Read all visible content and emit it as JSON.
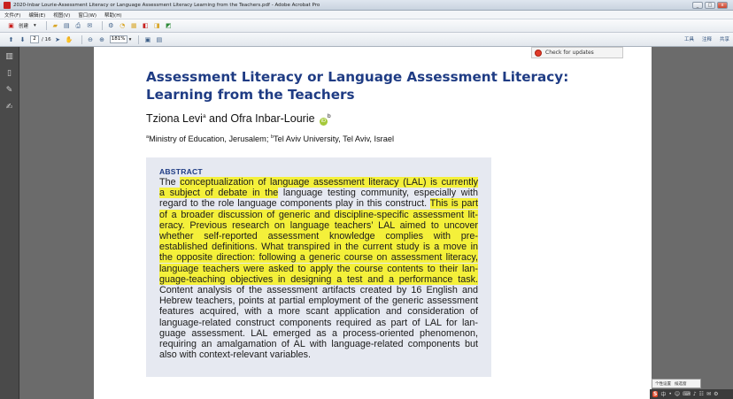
{
  "window": {
    "title": "2020-Inbar Lourie-Assessment Literacy or Language Assessment Literacy Learning from the Teachers.pdf - Adobe Acrobat Pro",
    "minimize": "_",
    "maximize": "□",
    "close": "x"
  },
  "menu": [
    "文件(F)",
    "编辑(E)",
    "视图(V)",
    "窗口(W)",
    "帮助(H)"
  ],
  "toolbar": {
    "create_label": "创建",
    "page_current": "2",
    "page_total": "/ 16",
    "zoom": "181%",
    "right_tools": [
      "工具",
      "注释",
      "共享"
    ]
  },
  "check_updates": "Check for updates",
  "paper": {
    "title": "Assessment Literacy or Language Assessment Literacy: Learning from the Teachers",
    "author1": "Tziona Levi",
    "author1_sup": "a",
    "and": " and Ofra Inbar-Lourie ",
    "orcid": "iD",
    "author2_sup": "b",
    "affil_a_sup": "a",
    "affil_a": "Ministry of Education, Jerusalem; ",
    "affil_b_sup": "b",
    "affil_b": "Tel Aviv University, Tel Aviv, Israel",
    "abstract_heading": "ABSTRACT",
    "abstract_lines": [
      {
        "pre": "The ",
        "hl": "conceptualization of language assessment literacy (LAL) is currently",
        "post": ""
      },
      {
        "pre": "",
        "hl": "a subject of debate in the",
        "post": " language testing community, especially with"
      },
      {
        "pre": "regard to the role language components play in this construct. ",
        "hl": "This is part",
        "post": ""
      },
      {
        "pre": "",
        "hl": "of a broader discussion of generic and discipline-specific assessment lit-",
        "post": ""
      },
      {
        "pre": "",
        "hl": "eracy. Previous research on language teachers’ LAL aimed to uncover",
        "post": ""
      },
      {
        "pre": "",
        "hl": "whether self-reported assessment knowledge complies with pre-",
        "post": ""
      },
      {
        "pre": "",
        "hl": "established definitions. What transpired in the current study is a move in",
        "post": ""
      },
      {
        "pre": "",
        "hl": "the opposite direction: following a generic course on assessment literacy,",
        "post": ""
      },
      {
        "pre": "",
        "hl": "language teachers were asked to apply the course contents to their lan-",
        "post": ""
      },
      {
        "pre": "",
        "hl": "guage-teaching objectives in designing a test and a performance task.",
        "post": ""
      },
      {
        "pre": "Content analysis of the assessment artifacts created by 16 English and",
        "hl": "",
        "post": ""
      },
      {
        "pre": "Hebrew teachers, points at partial employment of the generic assessment",
        "hl": "",
        "post": ""
      },
      {
        "pre": "features acquired, with a more scant application and consideration of",
        "hl": "",
        "post": ""
      },
      {
        "pre": "language-related construct components required as part of LAL for lan-",
        "hl": "",
        "post": ""
      },
      {
        "pre": "guage assessment. LAL emerged as a process-oriented phenomenon,",
        "hl": "",
        "post": ""
      },
      {
        "pre": "requiring an amalgamation of AL with language-related components but",
        "hl": "",
        "post": ""
      },
      {
        "pre": "also with context-relevant variables.",
        "hl": "",
        "post": ""
      }
    ]
  },
  "ime": {
    "popup": [
      "个性设置",
      "候选窗"
    ],
    "tray": [
      "S",
      "中",
      "•",
      "☺",
      "⌨",
      "♪",
      "☷",
      "✉",
      "⚙"
    ]
  },
  "colors": {
    "title_blue": "#1f3c84",
    "highlight": "#f4f03a",
    "abstract_bg": "#e6e9f1"
  }
}
